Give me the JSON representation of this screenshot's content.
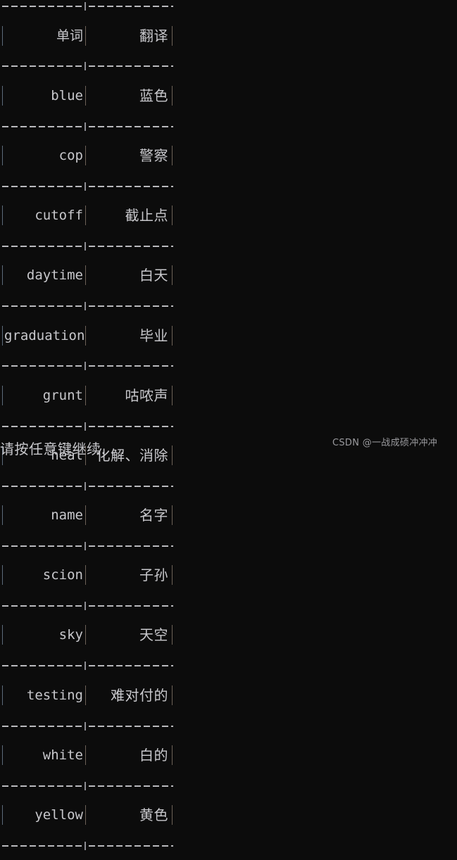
{
  "console": {
    "background_color": "#0c0c0c",
    "text_color": "#c8c8cc",
    "border_color": "#b9b9bd"
  },
  "table": {
    "headers": {
      "word": "单词",
      "translation": "翻译"
    },
    "rows": [
      {
        "word": "blue",
        "translation": "蓝色"
      },
      {
        "word": "cop",
        "translation": "警察"
      },
      {
        "word": "cutoff",
        "translation": "截止点"
      },
      {
        "word": "daytime",
        "translation": "白天"
      },
      {
        "word": "graduation",
        "translation": "毕业"
      },
      {
        "word": "grunt",
        "translation": "咕哝声"
      },
      {
        "word": "heal",
        "translation": "化解、消除"
      },
      {
        "word": "name",
        "translation": "名字"
      },
      {
        "word": "scion",
        "translation": "子孙"
      },
      {
        "word": "sky",
        "translation": "天空"
      },
      {
        "word": "testing",
        "translation": "难对付的"
      },
      {
        "word": "white",
        "translation": "白的"
      },
      {
        "word": "yellow",
        "translation": "黄色"
      }
    ]
  },
  "prompt": {
    "text": "请按任意键继续. . ."
  },
  "watermark": {
    "text": "CSDN @一战成硕冲冲冲"
  }
}
